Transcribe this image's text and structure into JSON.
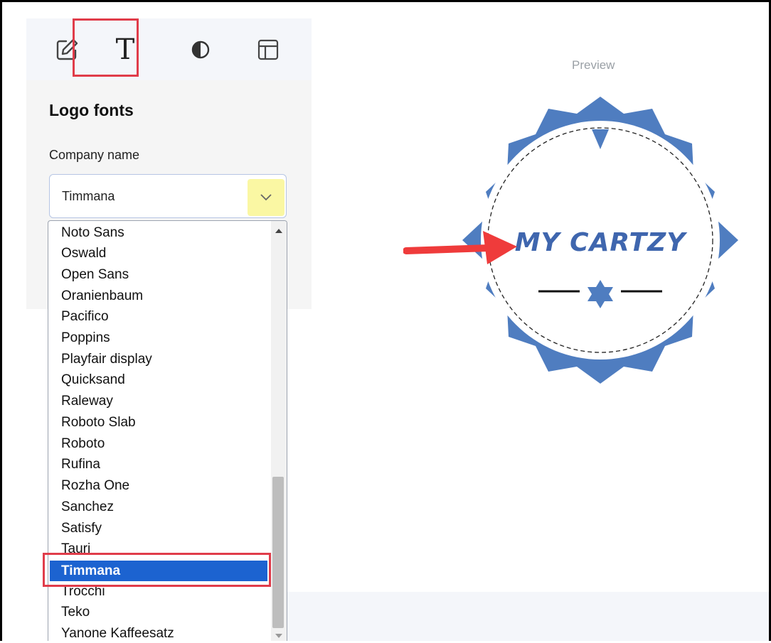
{
  "toolbar": {
    "tools": [
      "edit-icon",
      "text-icon",
      "contrast-icon",
      "layout-icon"
    ],
    "text_glyph": "T",
    "active_tool": "text-icon",
    "highlight_color": "#e03c4a"
  },
  "panel": {
    "title": "Logo fonts",
    "field_label": "Company name",
    "selected_value": "Timmana"
  },
  "dropdown": {
    "options": [
      "Noto Sans",
      "Oswald",
      "Open Sans",
      "Oranienbaum",
      "Pacifico",
      "Poppins",
      "Playfair display",
      "Quicksand",
      "Raleway",
      "Roboto Slab",
      "Roboto",
      "Rufina",
      "Rozha One",
      "Sanchez",
      "Satisfy",
      "Tauri",
      "Timmana",
      "Trocchi",
      "Teko",
      "Yanone Kaffeesatz"
    ],
    "selected": "Timmana",
    "selected_color": "#1c63d0"
  },
  "preview": {
    "label": "Preview",
    "logo_text": "MY CARTZY",
    "badge_color": "#4f7dc0"
  }
}
